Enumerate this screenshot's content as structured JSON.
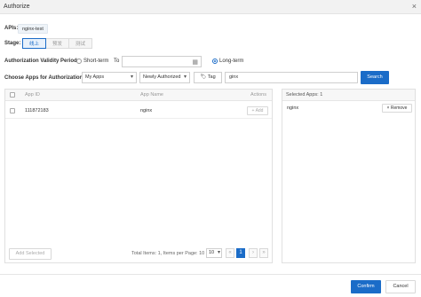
{
  "window": {
    "title": "Authorize",
    "close_glyph": "×"
  },
  "apis": {
    "label": "APIs:",
    "tags": [
      "nginx-test"
    ]
  },
  "stage": {
    "label": "Stage:",
    "options": [
      "线上",
      "预发",
      "测试"
    ],
    "selected": "线上"
  },
  "validity": {
    "label": "Authorization Validity Period:",
    "short_term_label": "Short-term",
    "to_label": "To",
    "date_value": "",
    "long_term_label": "Long-term",
    "selected": "Long-term"
  },
  "choose": {
    "label": "Choose Apps for Authorization:",
    "scope_select": "My Apps",
    "status_select": "Newly Authorized",
    "tag_button": "Tag",
    "search_value": "ginx",
    "search_button": "Search"
  },
  "apps_table": {
    "headers": {
      "app_id": "App ID",
      "app_name": "App Name",
      "actions": "Actions"
    },
    "rows": [
      {
        "app_id": "111872183",
        "app_name": "nginx",
        "action": "+ Add"
      }
    ],
    "add_selected": "Add Selected",
    "pagination": {
      "summary": "Total Items: 1, Items per Page: 10",
      "page_size": "10",
      "current_page": "1",
      "first": "«",
      "prev": "‹",
      "next": "›",
      "last": "»"
    }
  },
  "selected_panel": {
    "header": "Selected Apps: 1",
    "items": [
      {
        "name": "nginx",
        "remove_label": "× Remove"
      }
    ]
  },
  "footer": {
    "confirm": "Confirm",
    "cancel": "Cancel"
  },
  "colors": {
    "primary": "#1b6cc8",
    "border": "#e0e0e0",
    "muted": "#999999"
  },
  "icons": [
    "close-icon",
    "calendar-icon",
    "tag-icon",
    "caret-down-icon"
  ]
}
